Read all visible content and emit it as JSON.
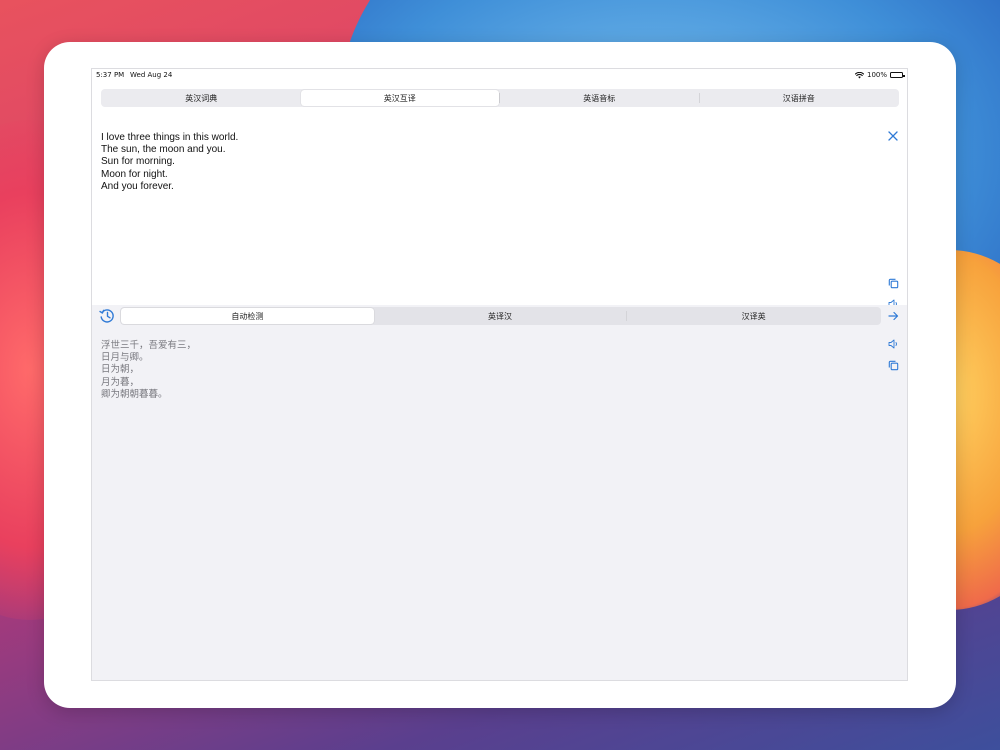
{
  "status_bar": {
    "time": "5:37 PM",
    "date": "Wed Aug 24",
    "battery": "100%"
  },
  "top_tabs": {
    "items": [
      {
        "label": "英汉词典",
        "selected": false
      },
      {
        "label": "英汉互译",
        "selected": true
      },
      {
        "label": "英语音标",
        "selected": false
      },
      {
        "label": "汉语拼音",
        "selected": false
      }
    ]
  },
  "input": {
    "lines": [
      "I love three things in this world.",
      "The sun, the moon and you.",
      "Sun for morning.",
      "Moon for night.",
      "And you forever."
    ]
  },
  "direction_tabs": {
    "items": [
      {
        "label": "自动检测",
        "selected": true
      },
      {
        "label": "英译汉",
        "selected": false
      },
      {
        "label": "汉译英",
        "selected": false
      }
    ]
  },
  "output": {
    "lines": [
      "浮世三千，吾爱有三，",
      "日月与卿。",
      "日为朝，",
      "月为暮，",
      "卿为朝朝暮暮。"
    ]
  },
  "icons": {
    "clear": "close-icon",
    "copy": "copy-icon",
    "speak": "speaker-icon",
    "history": "history-icon",
    "translate": "arrow-right-icon"
  },
  "colors": {
    "accent": "#2f7ad6",
    "output_text": "#7a7a80"
  }
}
